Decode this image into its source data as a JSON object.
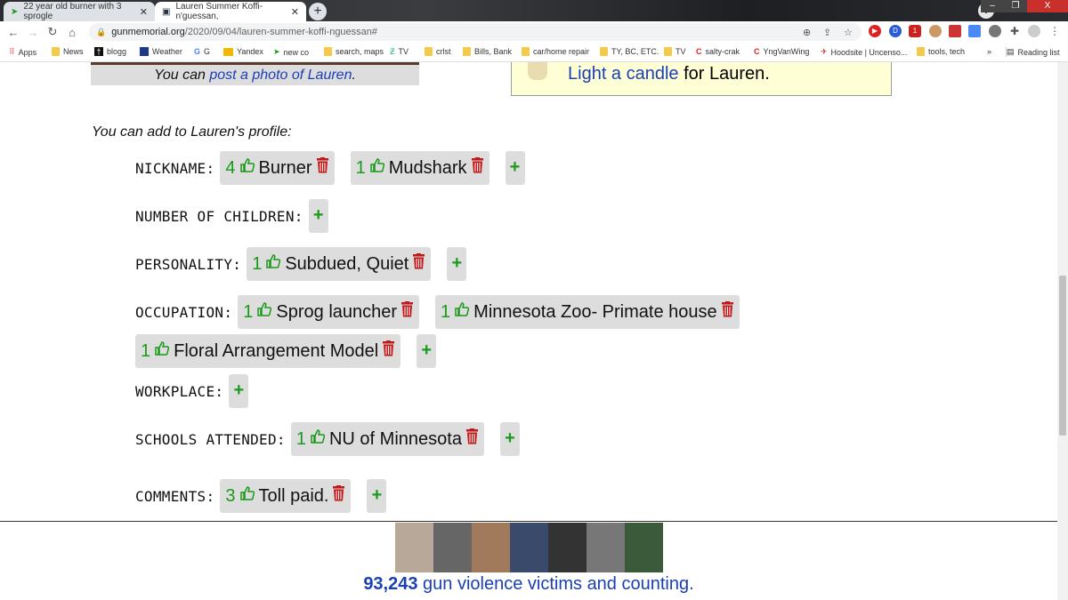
{
  "browser": {
    "tabs": [
      {
        "title": "22 year old burner with 3 sprogle",
        "active": false
      },
      {
        "title": "Lauren Summer Koffi-n'guessan,",
        "active": true
      }
    ],
    "url_domain": "gunmemorial.org",
    "url_path": "/2020/09/04/lauren-summer-koffi-nguessan#",
    "bookmarks": [
      "Apps",
      "News",
      "blogg",
      "Weather",
      "G",
      "Yandex",
      "new co",
      "search, maps",
      "TV",
      "crlst",
      "Bills, Bank",
      "car/home repair",
      "TY, BC, ETC.",
      "TV",
      "salty-crak",
      "YngVanWing",
      "Hoodsite | Uncenso...",
      "tools, tech"
    ],
    "more": "»",
    "reading_list": "Reading list",
    "extension_badge": "1"
  },
  "photo": {
    "prefix": "You can ",
    "link": "post a photo of Lauren",
    "suffix": "."
  },
  "candle": {
    "link": "Light a candle",
    "suffix": " for Lauren."
  },
  "intro": "You can add to Lauren's profile:",
  "fields": [
    {
      "label": "NICKNAME:",
      "entries": [
        {
          "count": "4",
          "text": "Burner"
        },
        {
          "count": "1",
          "text": "Mudshark"
        }
      ]
    },
    {
      "label": "NUMBER OF CHILDREN:",
      "entries": []
    },
    {
      "label": "PERSONALITY:",
      "entries": [
        {
          "count": "1",
          "text": "Subdued, Quiet"
        }
      ]
    },
    {
      "label": "OCCUPATION:",
      "entries": [
        {
          "count": "1",
          "text": "Sprog launcher"
        },
        {
          "count": "1",
          "text": "Minnesota Zoo- Primate house"
        },
        {
          "count": "1",
          "text": "Floral Arrangement Model"
        }
      ]
    },
    {
      "label": "WORKPLACE:",
      "entries": []
    },
    {
      "label": "SCHOOLS ATTENDED:",
      "entries": [
        {
          "count": "1",
          "text": "NU of Minnesota"
        }
      ]
    },
    {
      "label": "COMMENTS:",
      "entries": [
        {
          "count": "3",
          "text": "Toll paid."
        }
      ]
    }
  ],
  "plus": "+",
  "footer": {
    "count": "93,243",
    "text": " gun violence victims and counting."
  },
  "colors": {
    "green": "#1a9a1a",
    "red": "#c01818",
    "link": "#1a3fb5",
    "chip": "#dddddd"
  }
}
